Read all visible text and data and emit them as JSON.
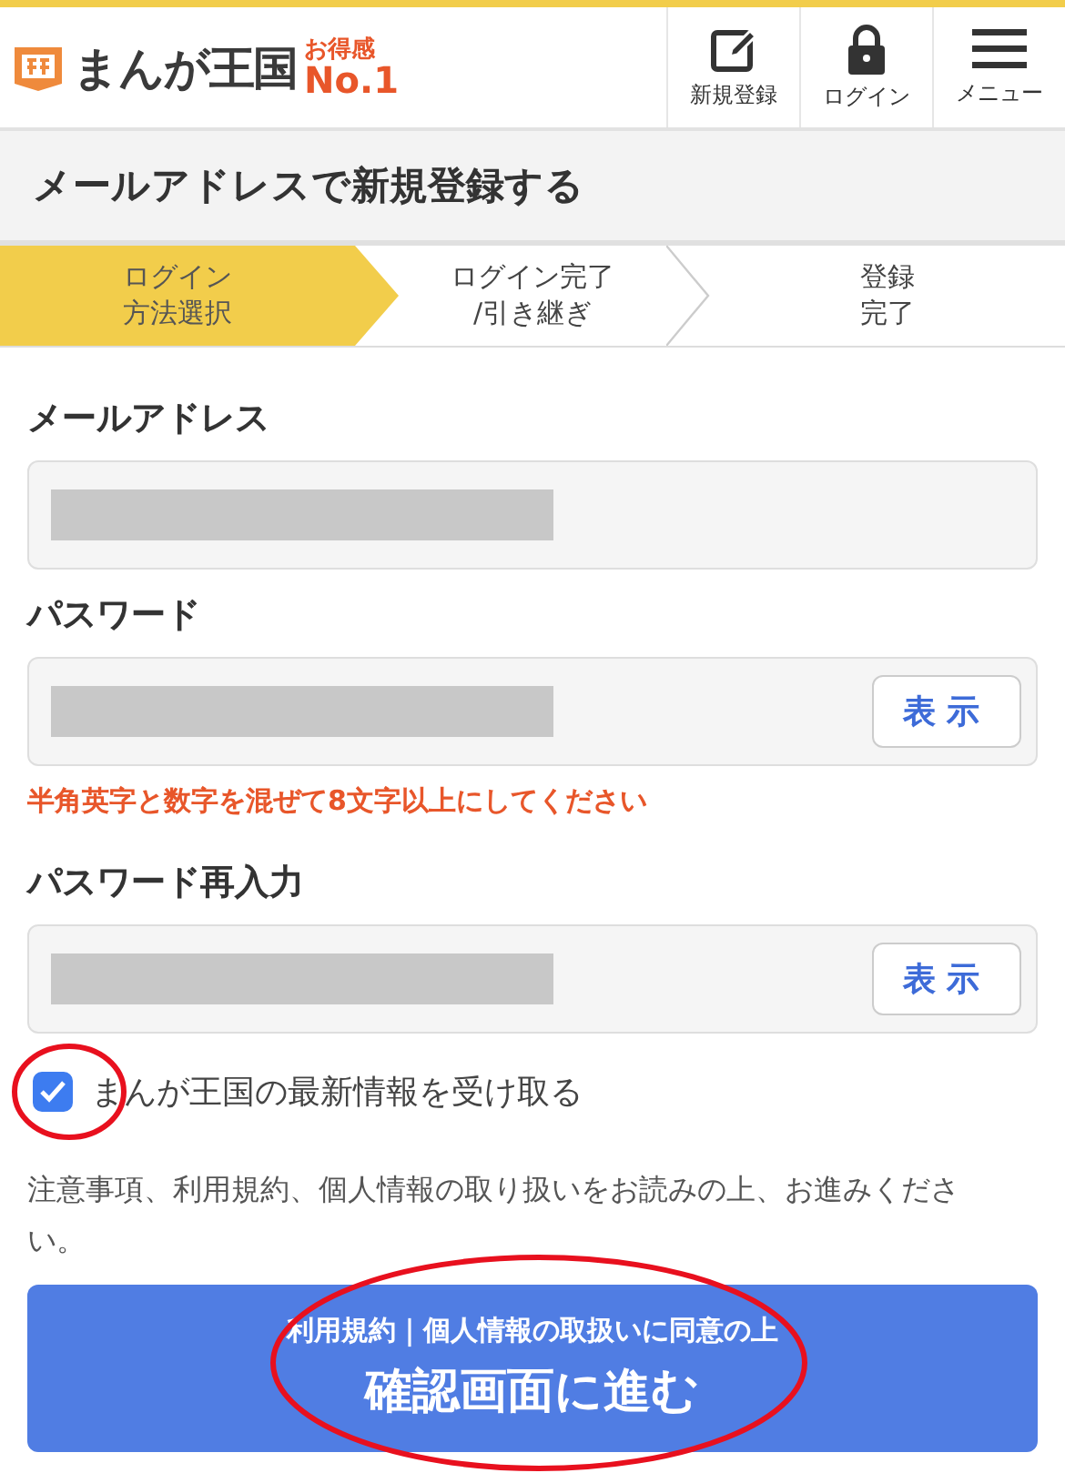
{
  "header": {
    "logo": {
      "name": "まんが王国",
      "badge_top": "お得感",
      "badge_bottom": "No.1"
    },
    "nav": [
      {
        "kind": "edit",
        "label": "新規登録"
      },
      {
        "kind": "lock",
        "label": "ログイン"
      },
      {
        "kind": "menu",
        "label": "メニュー"
      }
    ]
  },
  "page_title": "メールアドレスで新規登録する",
  "steps": [
    {
      "lines": [
        "ログイン",
        "方法選択"
      ],
      "selected": true
    },
    {
      "lines": [
        "ログイン完了",
        "/引き継ぎ"
      ],
      "selected": false
    },
    {
      "lines": [
        "登録",
        "完了"
      ],
      "selected": false
    }
  ],
  "form": {
    "fields": [
      {
        "label": "メールアドレス",
        "redacted": true
      },
      {
        "label": "パスワード",
        "redacted": true,
        "show_button": "表示",
        "hint": "半角英字と数字を混ぜて8文字以上にしてください"
      },
      {
        "label": "パスワード再入力",
        "redacted": true,
        "show_button": "表示"
      }
    ],
    "newsletter": {
      "label": "まんが王国の最新情報を受け取る",
      "checked": true
    },
    "notice": "注意事項、利用規約、個人情報の取り扱いをお読みの上、お進みください。",
    "submit": {
      "subtitle": "利用規約｜個人情報の取扱いに同意の上",
      "label": "確認画面に進む"
    }
  }
}
